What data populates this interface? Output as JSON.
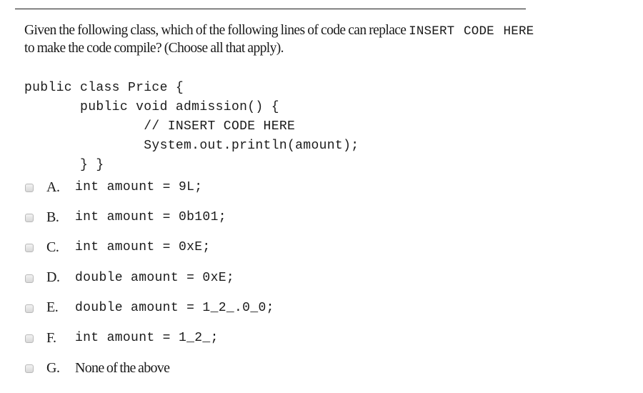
{
  "question": {
    "line1_prefix": "Given the following class, which of the following lines of code can replace ",
    "line1_code": "INSERT  CODE  HERE",
    "line2": "to make the code compile? (Choose all that apply)."
  },
  "code_block": {
    "lines": [
      "public class Price {",
      "       public void admission() {",
      "               // INSERT CODE HERE",
      "               System.out.println(amount);",
      "       } }"
    ]
  },
  "options": [
    {
      "letter": "A.",
      "text": "int amount = 9L;",
      "is_code": true,
      "checked": false
    },
    {
      "letter": "B.",
      "text": "int amount = 0b101;",
      "is_code": true,
      "checked": false
    },
    {
      "letter": "C.",
      "text": "int amount = 0xE;",
      "is_code": true,
      "checked": false
    },
    {
      "letter": "D.",
      "text": "double amount = 0xE;",
      "is_code": true,
      "checked": false
    },
    {
      "letter": "E.",
      "text": "double amount = 1_2_.0_0;",
      "is_code": true,
      "checked": false
    },
    {
      "letter": "F.",
      "text": "int amount = 1_2_;",
      "is_code": true,
      "checked": false
    },
    {
      "letter": "G.",
      "text": "None of the above",
      "is_code": false,
      "checked": false
    }
  ]
}
